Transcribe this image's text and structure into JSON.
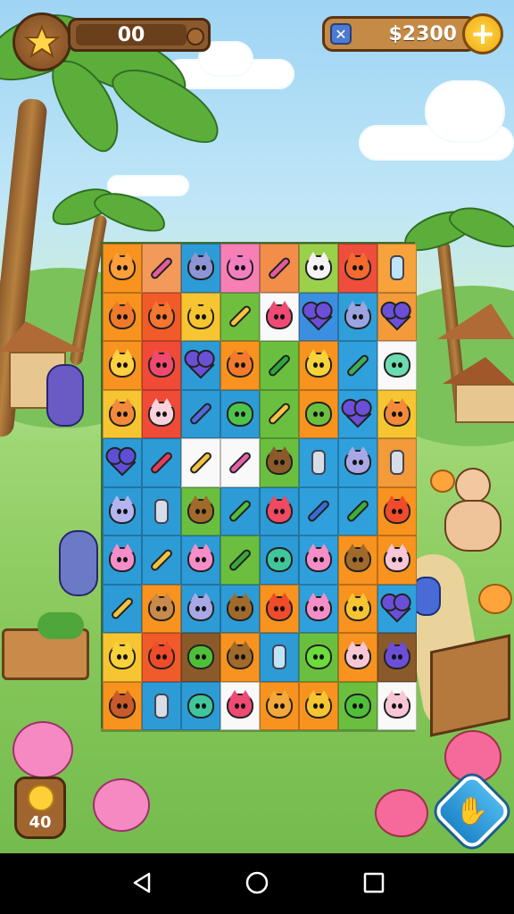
{
  "hud": {
    "star_score": "00",
    "coins": "$2300",
    "plus_label": "+",
    "currency_icon": "x-gem-icon"
  },
  "booster": {
    "count": "40",
    "icon": "sun-icon"
  },
  "hint_button": {
    "icon": "hint-icon",
    "glyph": "✋"
  },
  "board": {
    "rows": 10,
    "cols": 8,
    "tiles": [
      [
        [
          "lion",
          "#f7931e",
          "#ff9f3a"
        ],
        [
          "candy",
          "#f39a5a",
          "#e35b9a"
        ],
        [
          "cat",
          "#2d9bd6",
          "#8e95d6"
        ],
        [
          "pig",
          "#f77fb4",
          "#f47fc0"
        ],
        [
          "candy",
          "#f28d4a",
          "#e35b9a"
        ],
        [
          "dog",
          "#9bd04a",
          "#f3f3f3"
        ],
        [
          "fox",
          "#f04e3c",
          "#f56a2e"
        ],
        [
          "bottle",
          "#f7a23a",
          "#bfe4f7"
        ]
      ],
      [
        [
          "fox",
          "#f7931e",
          "#f07a2a"
        ],
        [
          "fox",
          "#f15b2a",
          "#f5762e"
        ],
        [
          "cat",
          "#f7c531",
          "#f7c531"
        ],
        [
          "bar",
          "#6fbf3f",
          "#f5c342"
        ],
        [
          "pig",
          "#f9f9f9",
          "#ee4a73"
        ],
        [
          "heart",
          "#3a8fe0",
          "#6b4fd6"
        ],
        [
          "dog",
          "#2f9fd9",
          "#9aa4e0"
        ],
        [
          "heart",
          "#f39a3a",
          "#6b4fd6"
        ]
      ],
      [
        [
          "cat",
          "#f7931e",
          "#ffd040"
        ],
        [
          "pig",
          "#f04b37",
          "#ef4a6e"
        ],
        [
          "heart",
          "#2d9bd6",
          "#6b4fd6"
        ],
        [
          "cat",
          "#f7931e",
          "#f37a2a"
        ],
        [
          "bar",
          "#6bbf3f",
          "#2fa63a"
        ],
        [
          "cat",
          "#f7931e",
          "#f7d23a"
        ],
        [
          "bar",
          "#2fa0dc",
          "#3fae58"
        ],
        [
          "blob",
          "#f9f9f9",
          "#6bdcb0"
        ]
      ],
      [
        [
          "cat",
          "#f7c531",
          "#f28a3a"
        ],
        [
          "pig",
          "#f04b37",
          "#fbd2dc"
        ],
        [
          "bar",
          "#2d9bd6",
          "#4f6ad6"
        ],
        [
          "blob",
          "#2d9bd6",
          "#4fc24a"
        ],
        [
          "bar",
          "#6bbf3f",
          "#f5c342"
        ],
        [
          "blob",
          "#f7931e",
          "#6bbf3f"
        ],
        [
          "heart",
          "#2fa0dc",
          "#6b4fd6"
        ],
        [
          "cat",
          "#f7c531",
          "#f28a3a"
        ]
      ],
      [
        [
          "heart",
          "#2d9bd6",
          "#5e4fd6"
        ],
        [
          "bar",
          "#2d9bd6",
          "#e83a5a"
        ],
        [
          "bar",
          "#f9f9f9",
          "#f5c342"
        ],
        [
          "bar",
          "#f9f9f9",
          "#e860a8"
        ],
        [
          "moose",
          "#6bbf3f",
          "#8a5a2b"
        ],
        [
          "bottle",
          "#2fa0dc",
          "#d6dde6"
        ],
        [
          "cat",
          "#2fa0dc",
          "#a8a8e6"
        ],
        [
          "bottle",
          "#f39a3a",
          "#d6dde6"
        ]
      ],
      [
        [
          "cat",
          "#2d9bd6",
          "#b4b4f0"
        ],
        [
          "bottle",
          "#2d9bd6",
          "#d6dde6"
        ],
        [
          "moose",
          "#6bbf3f",
          "#a06a2b"
        ],
        [
          "bar",
          "#2d9bd6",
          "#4fbf3a"
        ],
        [
          "pig",
          "#2d9bd6",
          "#ee4a63"
        ],
        [
          "bar",
          "#2fa0dc",
          "#3a6ad6"
        ],
        [
          "bar",
          "#2fa0dc",
          "#3fae3a"
        ],
        [
          "fox",
          "#f7931e",
          "#f04b2a"
        ]
      ],
      [
        [
          "pig",
          "#2d9bd6",
          "#f58ec8"
        ],
        [
          "bar",
          "#2d9bd6",
          "#f5c342"
        ],
        [
          "pig",
          "#2d9bd6",
          "#f58ec8"
        ],
        [
          "bar",
          "#6bbf3f",
          "#3aa63a"
        ],
        [
          "blob",
          "#2d9bd6",
          "#3fc69a"
        ],
        [
          "pig",
          "#2fa0dc",
          "#f58ec8"
        ],
        [
          "dog",
          "#f7931e",
          "#a06a2b"
        ],
        [
          "pig",
          "#f7931e",
          "#f9c6d6"
        ]
      ],
      [
        [
          "bar",
          "#2d9bd6",
          "#f5c342"
        ],
        [
          "dog",
          "#f7931e",
          "#c98a4a"
        ],
        [
          "cat",
          "#2d9bd6",
          "#a8a8e6"
        ],
        [
          "dog",
          "#2d9bd6",
          "#a06a2b"
        ],
        [
          "fox",
          "#f7931e",
          "#f04b2a"
        ],
        [
          "pig",
          "#2fa0dc",
          "#f58ec8"
        ],
        [
          "cat",
          "#f7931e",
          "#f7c531"
        ],
        [
          "heart",
          "#2fa0dc",
          "#6b4fd6"
        ]
      ],
      [
        [
          "cat",
          "#f7c531",
          "#f7d23a"
        ],
        [
          "fox",
          "#f15b2a",
          "#f04b2a"
        ],
        [
          "blob",
          "#8a5a2b",
          "#4fbf3a"
        ],
        [
          "dog",
          "#f7931e",
          "#a06a2b"
        ],
        [
          "bottle",
          "#2d9bd6",
          "#bfe4f7"
        ],
        [
          "blob",
          "#6bbf3f",
          "#6bdc3a"
        ],
        [
          "pig",
          "#f7931e",
          "#f9c6d6"
        ],
        [
          "cat",
          "#8a5a2b",
          "#6b4fd6"
        ]
      ],
      [
        [
          "lion",
          "#f7931e",
          "#c95a2a"
        ],
        [
          "bottle",
          "#2d9bd6",
          "#d6dde6"
        ],
        [
          "blob",
          "#2d9bd6",
          "#3fc69a"
        ],
        [
          "pig",
          "#f9f9f9",
          "#ee4a73"
        ],
        [
          "cat",
          "#f7931e",
          "#f5a83a"
        ],
        [
          "cat",
          "#f7931e",
          "#f7c531"
        ],
        [
          "blob",
          "#6bbf3f",
          "#4fbf3a"
        ],
        [
          "pig",
          "#f9f9f9",
          "#f9c6d6"
        ]
      ]
    ]
  },
  "navbar": {
    "back_icon": "back-triangle-icon",
    "home_icon": "home-circle-icon",
    "recent_icon": "recent-square-icon"
  }
}
